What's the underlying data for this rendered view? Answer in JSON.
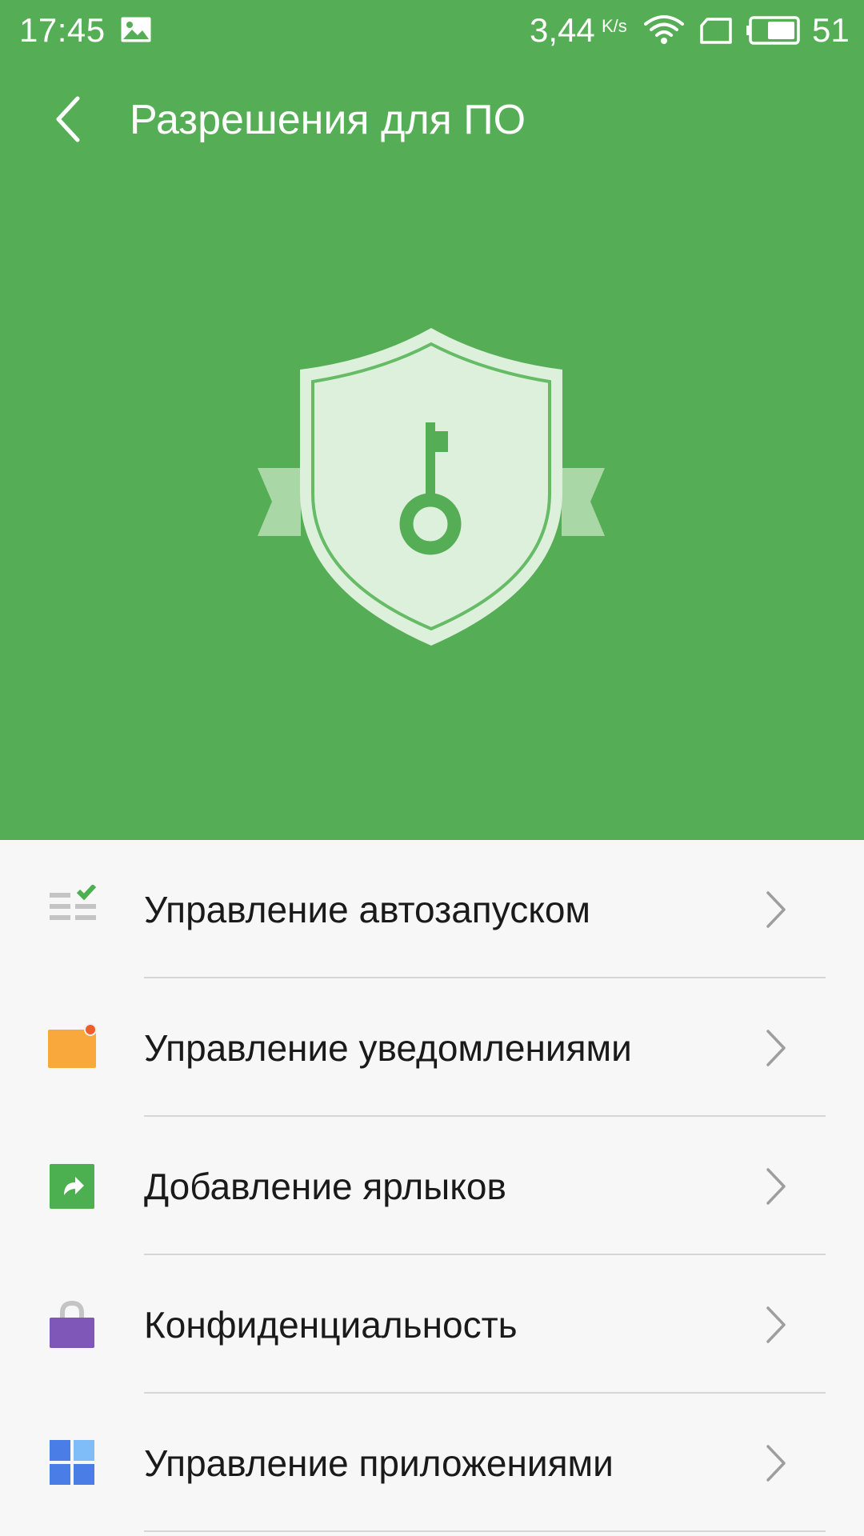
{
  "status_bar": {
    "time": "17:45",
    "speed": "3,44",
    "speed_unit": "K/s",
    "battery": "51",
    "icons": [
      "image-icon",
      "wifi-icon",
      "sim-card-icon",
      "battery-icon"
    ]
  },
  "header": {
    "back_icon": "chevron-left-icon",
    "title": "Разрешения для ПО"
  },
  "hero": {
    "background": "#55ae55",
    "illustration": "shield-key-icon"
  },
  "menu": {
    "items": [
      {
        "label": "Управление автозапуском",
        "icon": "autostart-list-icon",
        "color": "#4caf50"
      },
      {
        "label": "Управление уведомлениями",
        "icon": "notification-icon",
        "color": "#f9a93c"
      },
      {
        "label": "Добавление ярлыков",
        "icon": "shortcut-icon",
        "color": "#4caf50"
      },
      {
        "label": "Конфиденциальность",
        "icon": "privacy-lock-icon",
        "color": "#7e57b8"
      },
      {
        "label": "Управление приложениями",
        "icon": "app-grid-icon",
        "color": "#4a7ee6"
      }
    ],
    "chevron_icon": "chevron-right-icon"
  }
}
